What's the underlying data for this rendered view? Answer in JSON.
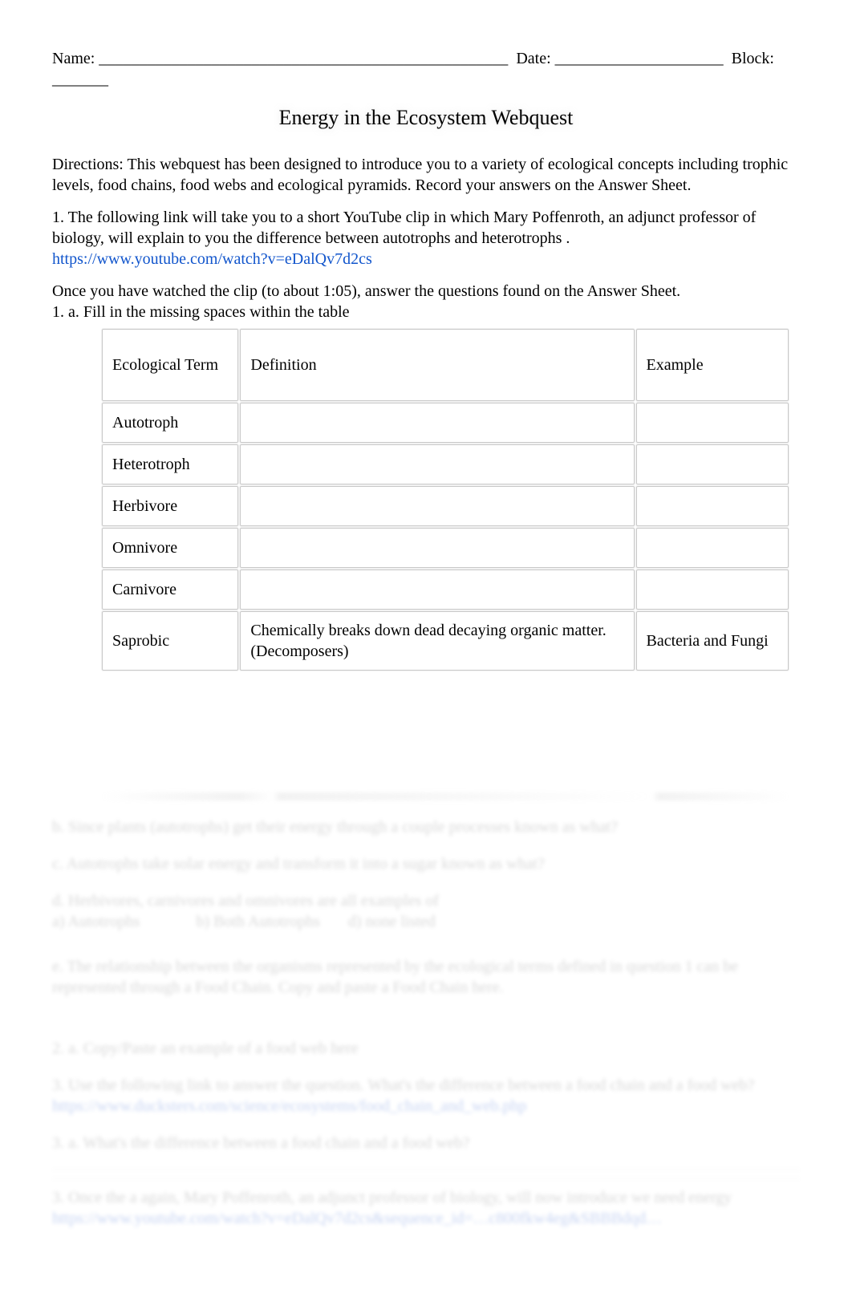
{
  "header": {
    "name_label": "Name: ___________________________________________________",
    "date_label": "Date: _____________________",
    "block_label": "Block: _______"
  },
  "title": "Energy in the Ecosystem Webquest",
  "directions": "Directions:  This webquest has been designed to introduce you to a variety of ecological concepts including trophic levels, food chains, food webs and ecological pyramids.  Record your answers on the Answer Sheet.",
  "q1_intro": "1. The following link will take you to a short YouTube clip in which Mary Poffenroth, an adjunct professor of biology, will explain to you the difference between autotrophs   and heterotrophs  .",
  "q1_link": {
    "href": "https://www.youtube.com/watch?v=eDalQv7d2cs",
    "text": "https://www.youtube.com/watch?v=eDalQv7d2cs"
  },
  "after_clip": "Once you have watched the clip (to about 1:05), answer the questions found on the Answer Sheet.",
  "q1a": "1. a. Fill in the missing spaces within the table",
  "table": {
    "headers": {
      "term": "Ecological Term",
      "def": "Definition",
      "ex": "Example"
    },
    "rows": [
      {
        "term": "Autotroph",
        "def": "",
        "ex": ""
      },
      {
        "term": "Heterotroph",
        "def": "",
        "ex": ""
      },
      {
        "term": "Herbivore",
        "def": "",
        "ex": ""
      },
      {
        "term": "Omnivore",
        "def": "",
        "ex": ""
      },
      {
        "term": "Carnivore",
        "def": "",
        "ex": ""
      },
      {
        "term": "Saprobic",
        "def": "Chemically breaks down dead decaying organic matter. (Decomposers)",
        "ex": "Bacteria and Fungi"
      }
    ]
  },
  "faded": {
    "f1": "b. Since plants (autotrophs) get their energy through a couple processes known as what?",
    "f2": "c. Autotrophs take solar energy and transform it into a sugar known as what?",
    "f3": "d. Herbivores, carnivores and omnivores are all examples of",
    "f3a": "a) Autotrophs",
    "f3b": "b) Both Autotrophs",
    "f3c": "d) none listed",
    "f4": "e. The relationship between the organisms represented by the ecological terms defined in question 1 can be represented through a Food Chain.  Copy and paste a Food Chain here.",
    "f5": "2. a.   Copy/Paste an example of a food web here",
    "f6": "3. Use the following link to answer the question.  What's the difference between a food chain  and a food web?",
    "f6_link": "https://www.ducksters.com/science/ecosystems/food_chain_and_web.php",
    "f7": "3. a.   What's the difference between a food chain  and a food web?",
    "f8": "3. Once the a again, Mary Poffenroth, an adjunct professor of biology, will now introduce we need energy",
    "f8_link": "https://www.youtube.com/watch?v=eDalQv7d2cs&sequence_id=…c800fkw4eg&SBBBdqd…"
  }
}
